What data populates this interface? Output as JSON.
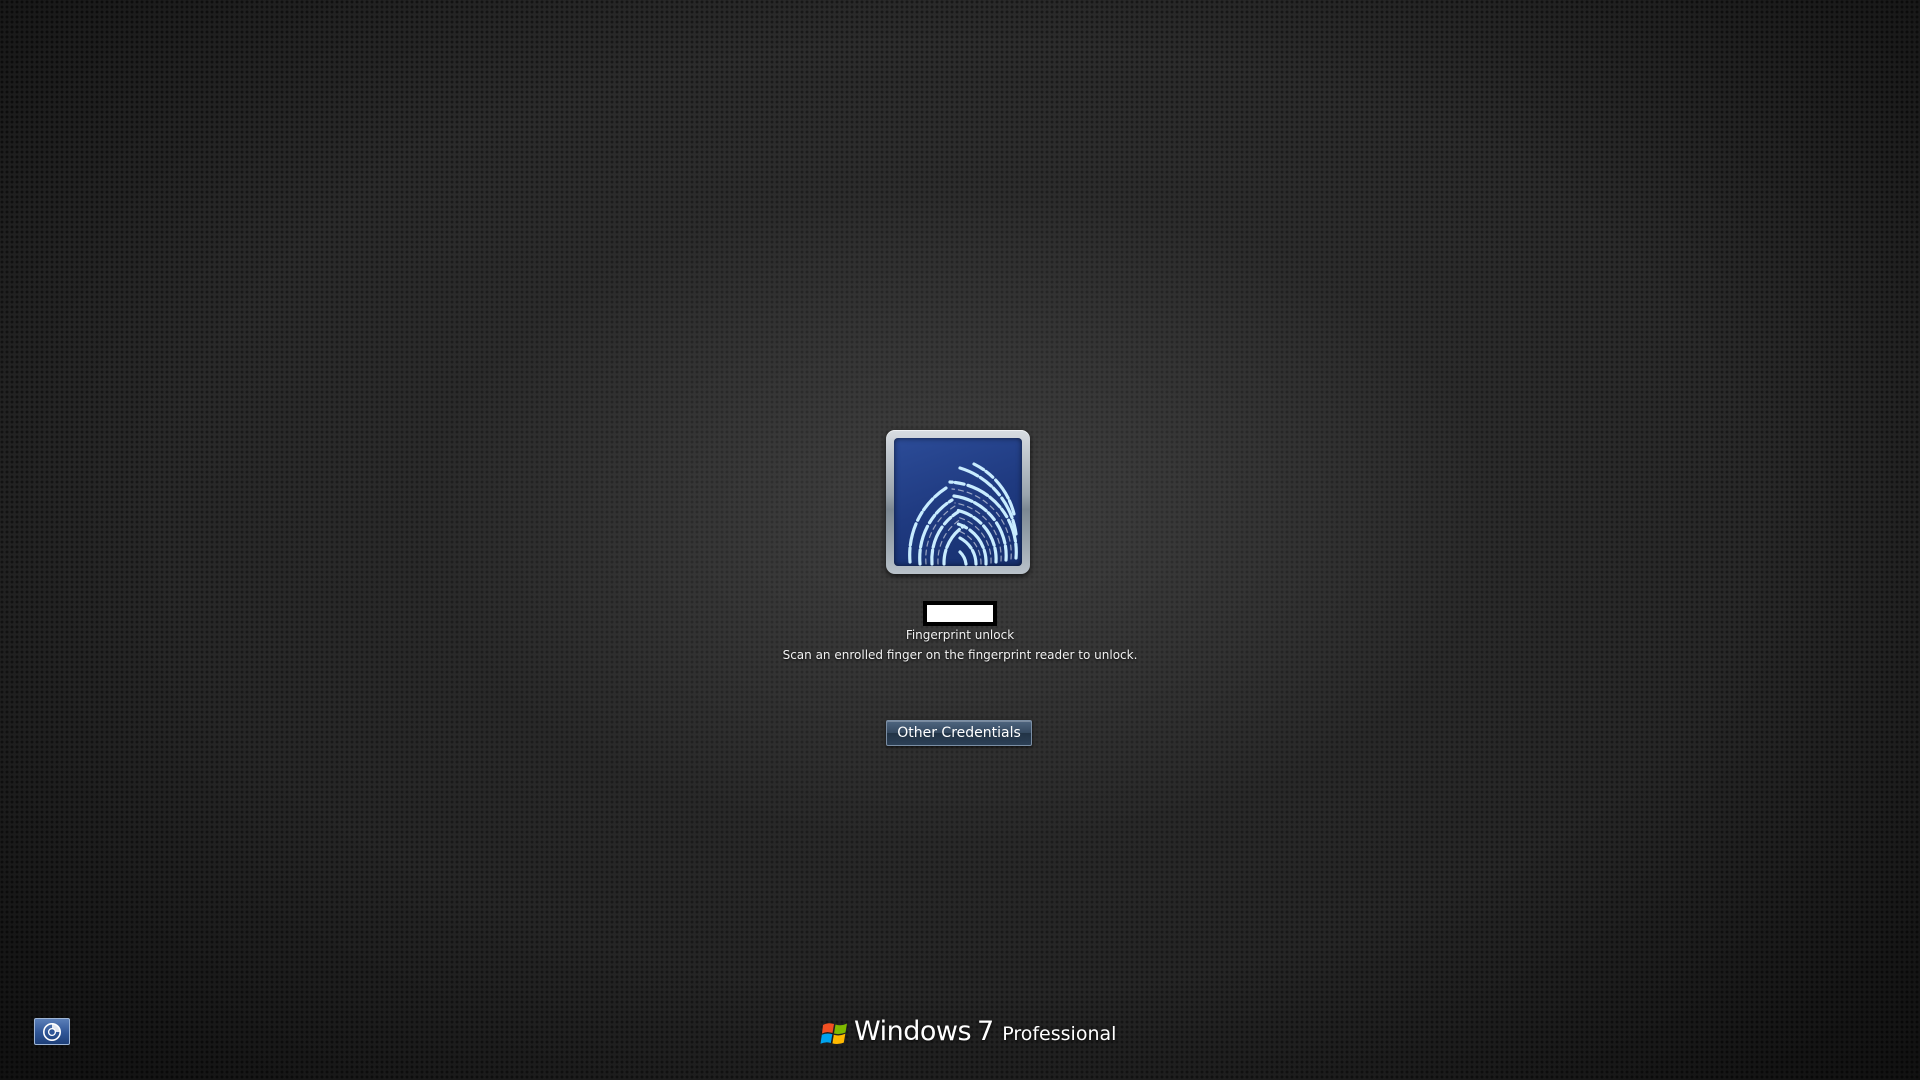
{
  "tile": {
    "icon": "fingerprint-icon",
    "background_color": "#1f3a80",
    "accent_color": "#bfe6ff"
  },
  "credential": {
    "username": "",
    "title": "Fingerprint unlock",
    "description": "Scan an enrolled finger on the fingerprint reader to unlock."
  },
  "other_credentials_button": {
    "label": "Other Credentials"
  },
  "ease_of_access": {
    "icon": "ease-of-access-icon"
  },
  "branding": {
    "product": "Windows",
    "version": "7",
    "edition": "Professional",
    "logo_icon": "windows-flag-icon"
  }
}
